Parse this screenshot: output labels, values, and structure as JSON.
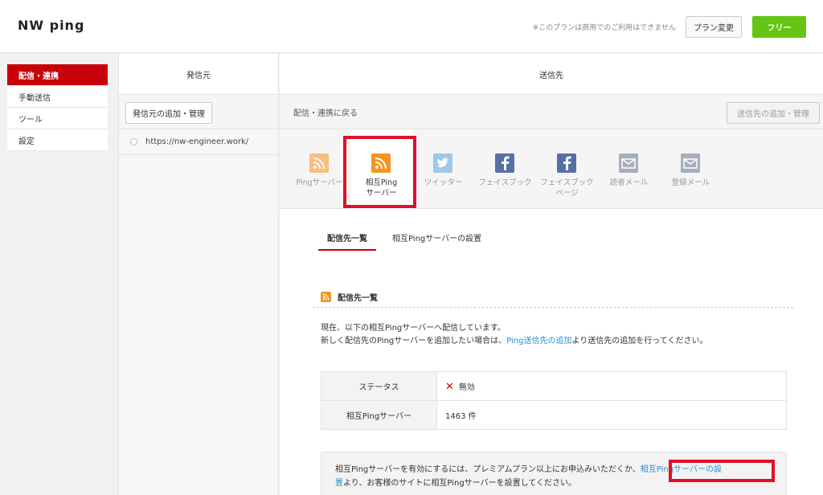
{
  "header": {
    "logo": "NW ping",
    "notice": "※このプランは商用でのご利用はできません",
    "plan_button": "プラン変更",
    "free_button": "フリー"
  },
  "sidebar": {
    "items": [
      {
        "label": "配信・連携",
        "active": true
      },
      {
        "label": "手動送信",
        "active": false
      },
      {
        "label": "ツール",
        "active": false
      },
      {
        "label": "設定",
        "active": false
      }
    ]
  },
  "source": {
    "heading": "発信元",
    "add_button": "発信元の追加・管理",
    "sites": [
      "https://nw-engineer.work/"
    ]
  },
  "destination": {
    "heading": "送信先",
    "back_link": "配信・連携に戻る",
    "add_button": "送信先の追加・管理",
    "services": [
      {
        "label": "Pingサーバー",
        "icon": "rss-icon",
        "color": "#f7931e"
      },
      {
        "label": "相互Ping\nサーバー",
        "icon": "rss-icon",
        "color": "#f7931e"
      },
      {
        "label": "ツイッター",
        "icon": "twitter-icon",
        "color": "#9fb6d9"
      },
      {
        "label": "フェイスブック",
        "icon": "facebook-icon",
        "color": "#3b5998"
      },
      {
        "label": "フェイスブック\nページ",
        "icon": "facebook-icon",
        "color": "#3b5998"
      },
      {
        "label": "読者メール",
        "icon": "mail-icon",
        "color": "#a6aebb"
      },
      {
        "label": "登録メール",
        "icon": "mail-icon",
        "color": "#a6aebb"
      }
    ],
    "tabs": [
      "配信先一覧",
      "相互Pingサーバーの設置"
    ],
    "section_title": "配信先一覧",
    "desc_line1": "現在、以下の相互Pingサーバーへ配信しています。",
    "desc_line2_pre": "新しく配信先のPingサーバーを追加したい場合は、",
    "desc_line2_link": "Ping送信先の追加",
    "desc_line2_post": "より送信先の追加を行ってください。",
    "table": [
      {
        "key": "ステータス",
        "value": "無効"
      },
      {
        "key": "相互Pingサーバー",
        "value": "1463 件"
      }
    ],
    "info_pre": "相互Pingサーバーを有効にするには、プレミアムプラン以上にお申込みいただくか、",
    "info_link_1": "相互Pingサーバーの設",
    "info_link_2": "置",
    "info_post": "より、お客様のサイトに相互Pingサーバーを設置してください。"
  },
  "colors": {
    "accent": "#c8000a",
    "free": "#65c414",
    "link": "#2a8fd0",
    "highlight": "#e0102a"
  }
}
